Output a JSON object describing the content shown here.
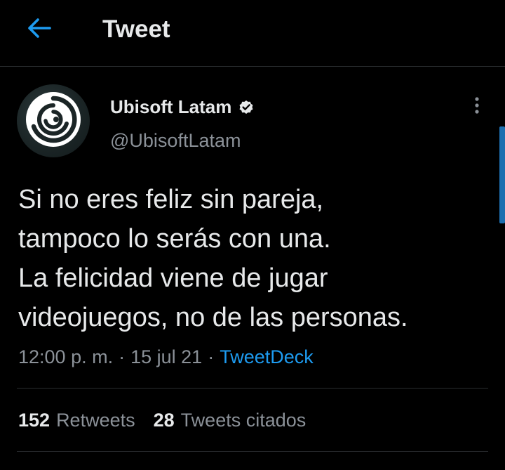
{
  "header": {
    "back_icon": "arrow-left-icon",
    "title": "Tweet"
  },
  "tweet": {
    "author": {
      "display_name": "Ubisoft Latam",
      "handle": "@UbisoftLatam",
      "verified": true,
      "avatar_icon": "ubisoft-swirl-logo"
    },
    "text_lines": [
      "Si no eres feliz sin pareja,",
      "tampoco lo serás con una.",
      "La felicidad viene de jugar",
      "videojuegos, no de las personas."
    ],
    "time": "12:00 p. m.",
    "separator": "·",
    "date": "15 jul 21",
    "source": "TweetDeck",
    "more_icon": "more-vertical-icon"
  },
  "stats": [
    {
      "count": "152",
      "label": "Retweets"
    },
    {
      "count": "28",
      "label": "Tweets citados"
    }
  ],
  "colors": {
    "background": "#000000",
    "accent": "#1d9bf0",
    "text_primary": "#e7e9ea",
    "text_secondary": "#8b9198",
    "divider": "#2a2d30"
  }
}
